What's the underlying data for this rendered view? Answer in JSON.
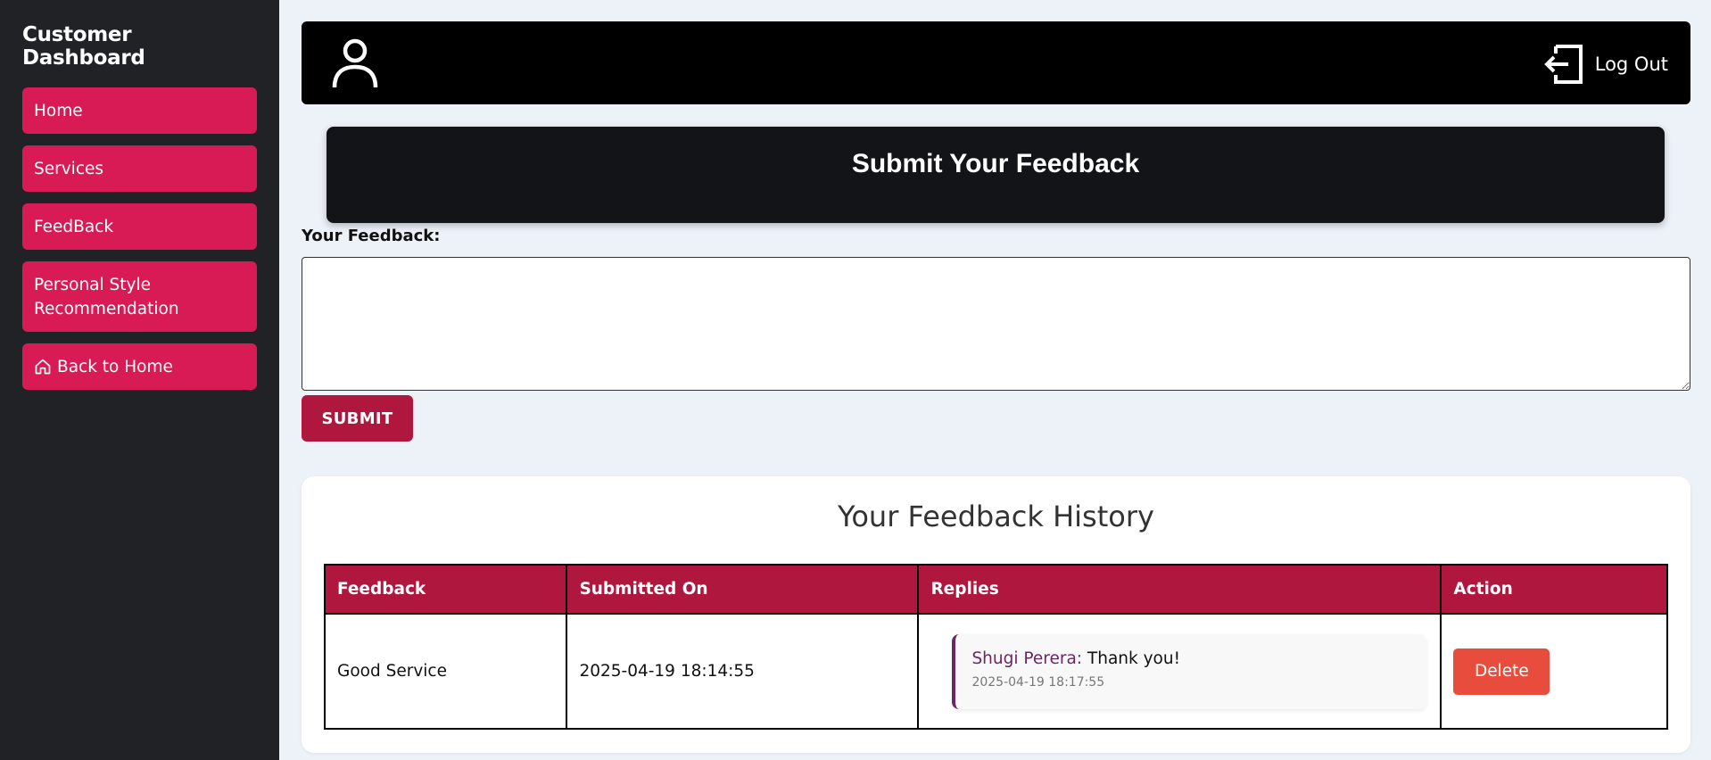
{
  "sidebar": {
    "title": "Customer Dashboard",
    "items": [
      {
        "label": "Home"
      },
      {
        "label": "Services"
      },
      {
        "label": "FeedBack"
      },
      {
        "label": "Personal Style Recommendation"
      },
      {
        "label": "Back to Home",
        "icon": "home-icon"
      }
    ]
  },
  "topbar": {
    "user_icon": "user-icon",
    "logout_icon": "logout-icon",
    "logout_label": "Log Out"
  },
  "feedback_form": {
    "title": "Submit Your Feedback",
    "label": "Your Feedback:",
    "value": "",
    "placeholder": "",
    "submit_label": "SUBMIT"
  },
  "history": {
    "title": "Your Feedback History",
    "columns": [
      "Feedback",
      "Submitted On",
      "Replies",
      "Action"
    ],
    "rows": [
      {
        "feedback": "Good Service",
        "submitted_on": "2025-04-19 18:14:55",
        "reply": {
          "author": "Shugi Perera:",
          "text": " Thank you!",
          "time": "2025-04-19 18:17:55"
        },
        "action_label": "Delete"
      }
    ]
  },
  "colors": {
    "sidebar_bg": "#202226",
    "nav_item": "#d81a55",
    "accent": "#b0173e",
    "delete": "#e74c3c",
    "reply_author": "#6b2663"
  }
}
